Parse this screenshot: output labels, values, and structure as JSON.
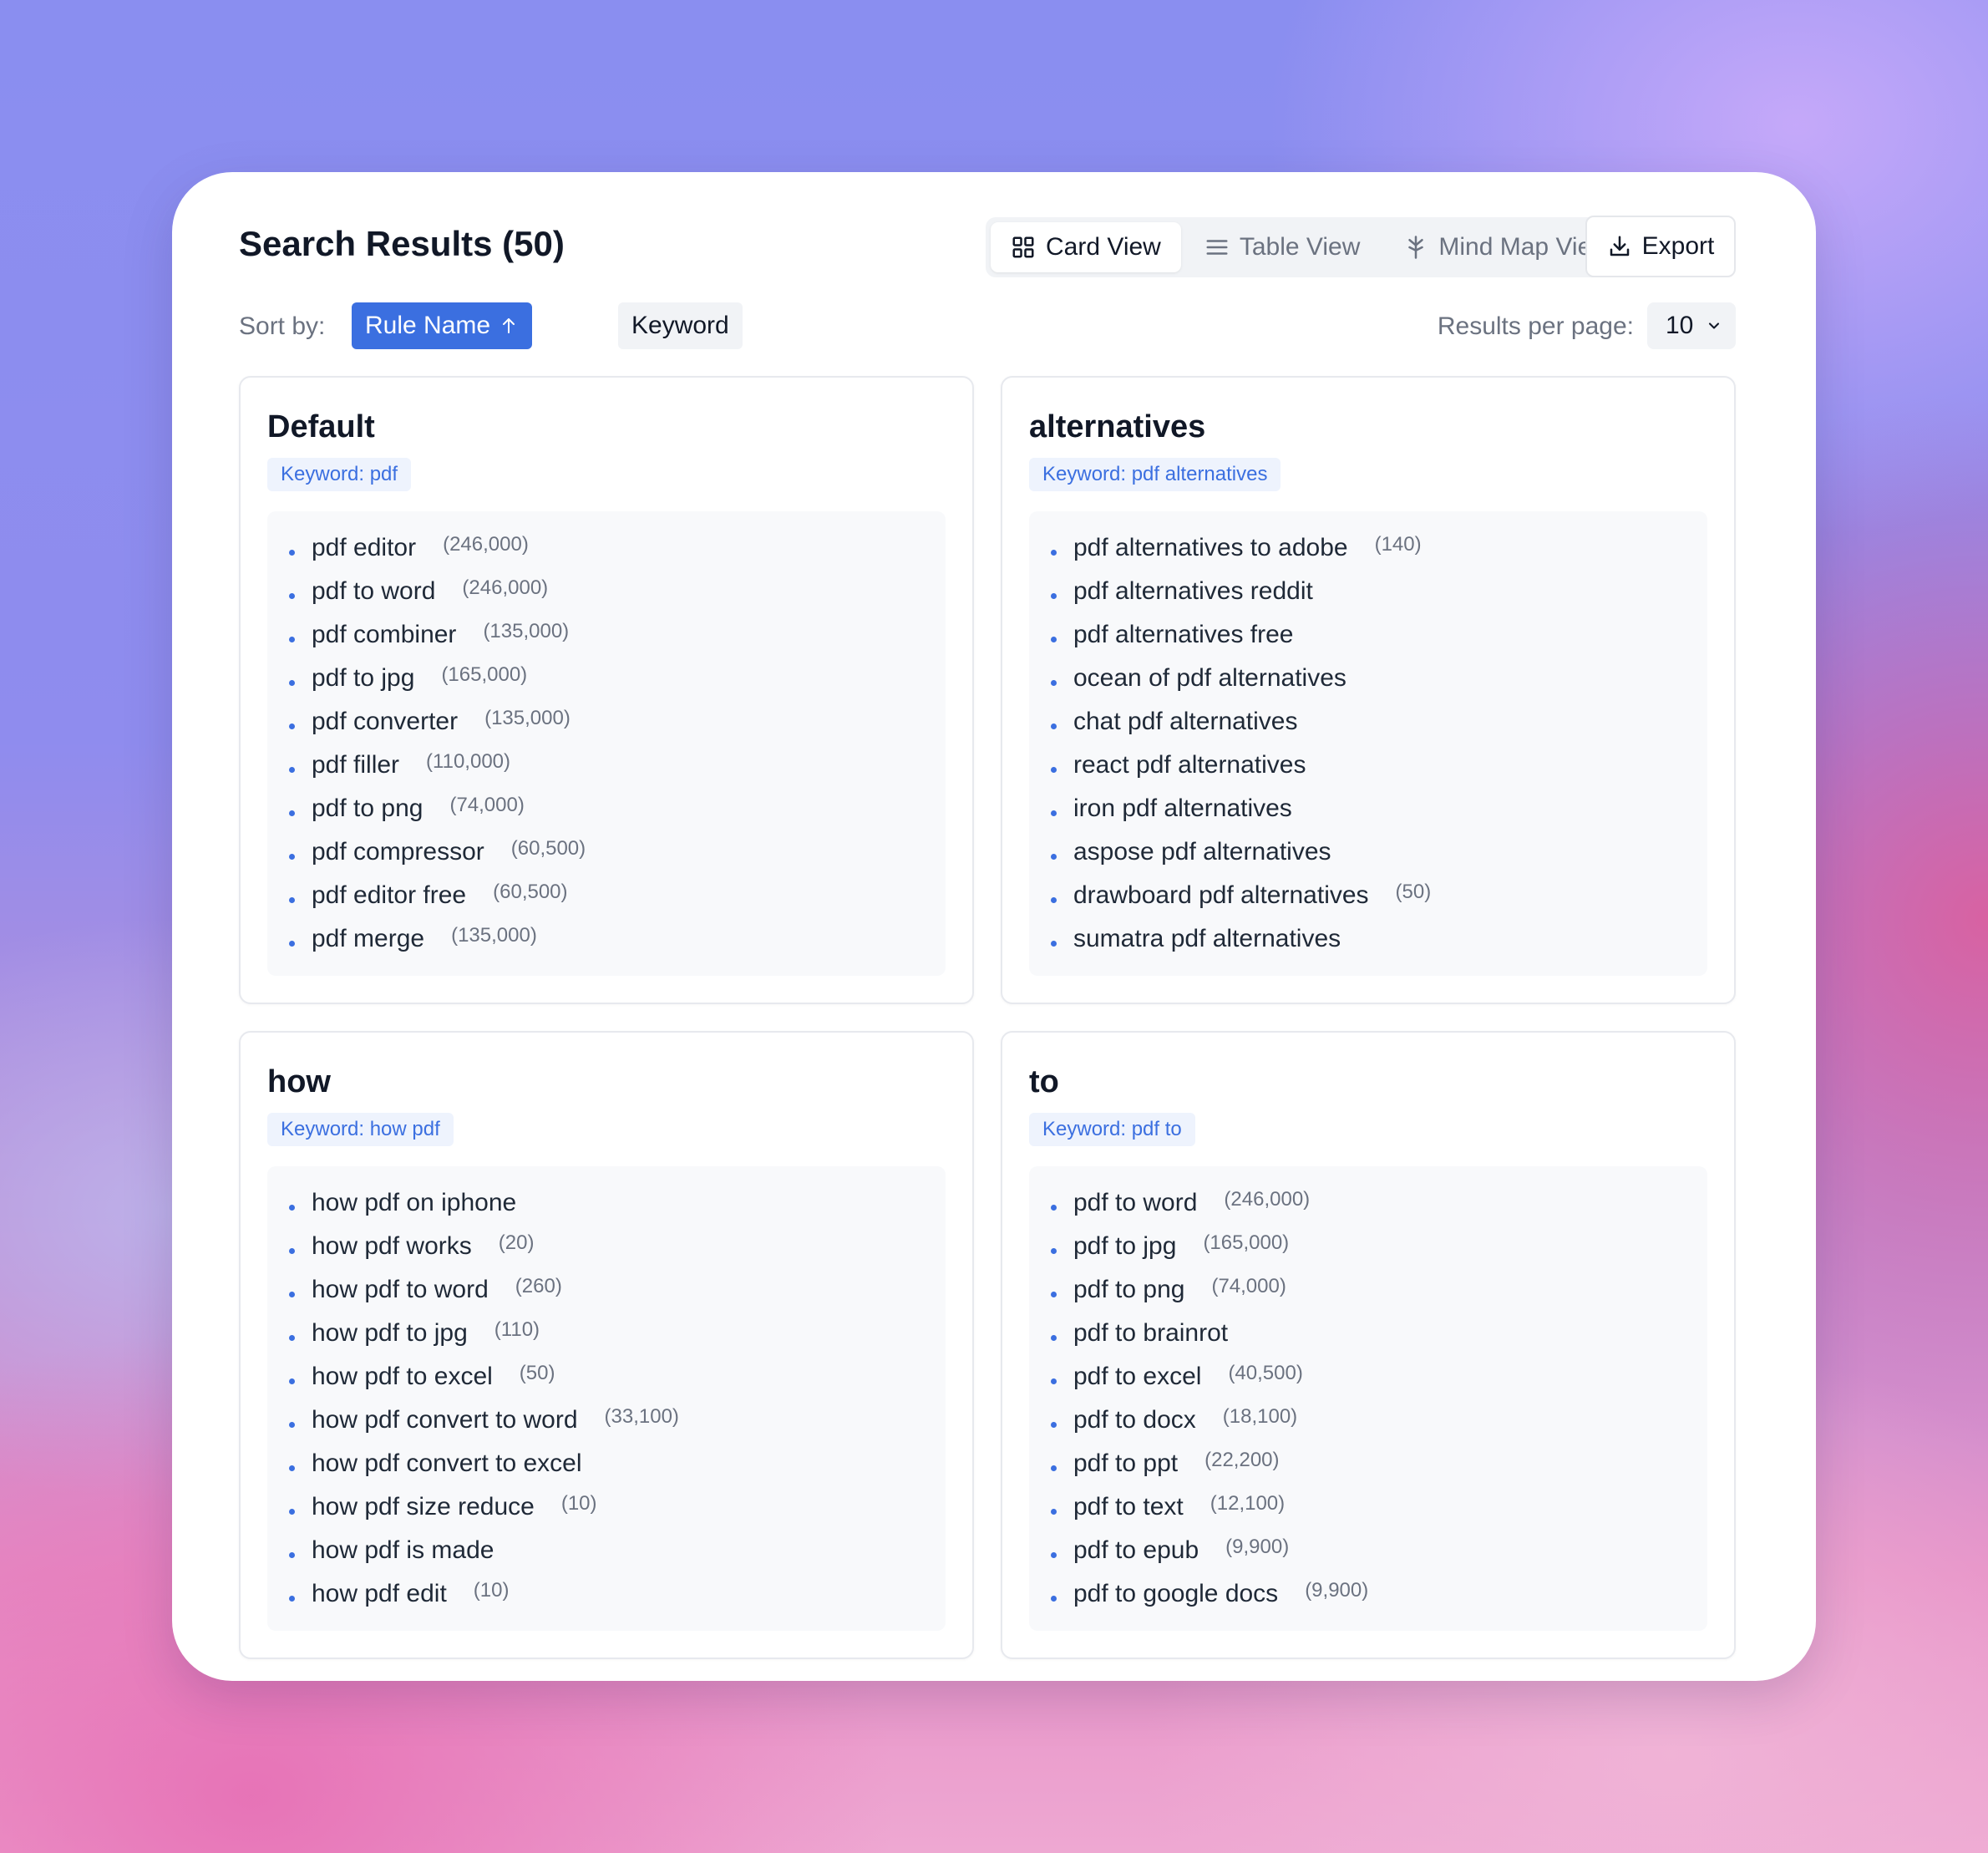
{
  "header": {
    "title": "Search Results (50)",
    "views": [
      {
        "label": "Card View",
        "icon": "grid-icon",
        "active": true
      },
      {
        "label": "Table View",
        "icon": "list-icon",
        "active": false
      },
      {
        "label": "Mind Map View",
        "icon": "mind-map-icon",
        "active": false
      }
    ],
    "export_label": "Export"
  },
  "sort": {
    "label": "Sort by:",
    "options": [
      {
        "label": "Rule Name",
        "active": true,
        "direction": "ascending"
      },
      {
        "label": "Keyword",
        "active": false
      }
    ],
    "results_per_page_label": "Results per page:",
    "results_per_page_value": "10"
  },
  "colors": {
    "accent": "#3b6fe0",
    "badge_bg": "#eef3fd"
  },
  "cards": [
    {
      "title": "Default",
      "keyword_badge": "Keyword: pdf",
      "items": [
        {
          "text": "pdf editor",
          "volume": "(246,000)"
        },
        {
          "text": "pdf to word",
          "volume": "(246,000)"
        },
        {
          "text": "pdf combiner",
          "volume": "(135,000)"
        },
        {
          "text": "pdf to jpg",
          "volume": "(165,000)"
        },
        {
          "text": "pdf converter",
          "volume": "(135,000)"
        },
        {
          "text": "pdf filler",
          "volume": "(110,000)"
        },
        {
          "text": "pdf to png",
          "volume": "(74,000)"
        },
        {
          "text": "pdf compressor",
          "volume": "(60,500)"
        },
        {
          "text": "pdf editor free",
          "volume": "(60,500)"
        },
        {
          "text": "pdf merge",
          "volume": "(135,000)"
        }
      ]
    },
    {
      "title": "alternatives",
      "keyword_badge": "Keyword: pdf alternatives",
      "items": [
        {
          "text": "pdf alternatives to adobe",
          "volume": "(140)"
        },
        {
          "text": "pdf alternatives reddit",
          "volume": ""
        },
        {
          "text": "pdf alternatives free",
          "volume": ""
        },
        {
          "text": "ocean of pdf alternatives",
          "volume": ""
        },
        {
          "text": "chat pdf alternatives",
          "volume": ""
        },
        {
          "text": "react pdf alternatives",
          "volume": ""
        },
        {
          "text": "iron pdf alternatives",
          "volume": ""
        },
        {
          "text": "aspose pdf alternatives",
          "volume": ""
        },
        {
          "text": "drawboard pdf alternatives",
          "volume": "(50)"
        },
        {
          "text": "sumatra pdf alternatives",
          "volume": ""
        }
      ]
    },
    {
      "title": "how",
      "keyword_badge": "Keyword: how pdf",
      "items": [
        {
          "text": "how pdf on iphone",
          "volume": ""
        },
        {
          "text": "how pdf works",
          "volume": "(20)"
        },
        {
          "text": "how pdf to word",
          "volume": "(260)"
        },
        {
          "text": "how pdf to jpg",
          "volume": "(110)"
        },
        {
          "text": "how pdf to excel",
          "volume": "(50)"
        },
        {
          "text": "how pdf convert to word",
          "volume": "(33,100)"
        },
        {
          "text": "how pdf convert to excel",
          "volume": ""
        },
        {
          "text": "how pdf size reduce",
          "volume": "(10)"
        },
        {
          "text": "how pdf is made",
          "volume": ""
        },
        {
          "text": "how pdf edit",
          "volume": "(10)"
        }
      ]
    },
    {
      "title": "to",
      "keyword_badge": "Keyword: pdf to",
      "items": [
        {
          "text": "pdf to word",
          "volume": "(246,000)"
        },
        {
          "text": "pdf to jpg",
          "volume": "(165,000)"
        },
        {
          "text": "pdf to png",
          "volume": "(74,000)"
        },
        {
          "text": "pdf to brainrot",
          "volume": ""
        },
        {
          "text": "pdf to excel",
          "volume": "(40,500)"
        },
        {
          "text": "pdf to docx",
          "volume": "(18,100)"
        },
        {
          "text": "pdf to ppt",
          "volume": "(22,200)"
        },
        {
          "text": "pdf to text",
          "volume": "(12,100)"
        },
        {
          "text": "pdf to epub",
          "volume": "(9,900)"
        },
        {
          "text": "pdf to google docs",
          "volume": "(9,900)"
        }
      ]
    }
  ]
}
